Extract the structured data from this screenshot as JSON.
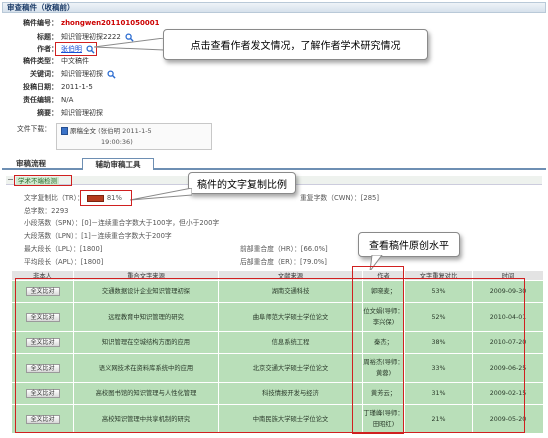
{
  "title": "审查稿件（收稿前）",
  "meta": {
    "manuscript_no_label": "稿件编号：",
    "manuscript_no": "zhongwen201101050001",
    "title_label": "标题：",
    "title_value": "知识管理初探2222",
    "author_label": "作者：",
    "author_value": "张伯明",
    "category_label": "稿件类型：",
    "category_value": "中文稿件",
    "keywords_label": "关键词：",
    "keywords_value": "知识管理初探",
    "date_label": "投稿日期：",
    "date_value": "2011-1-5",
    "editor_label": "责任编辑：",
    "editor_value": "N/A",
    "abstract_label": "摘要：",
    "abstract_value": "知识管理初探"
  },
  "file": {
    "label": "文件下载：",
    "name": "原稿全文",
    "info_line1": "(张伯明 2011-1-5",
    "info_line2": "19:00:36)"
  },
  "tabs": [
    "审稿流程",
    "辅助审稿工具"
  ],
  "section_label": "学术不端检测",
  "stats": {
    "copy_ratio_label": "文字复制比（TR）：",
    "copy_ratio_value": "81%",
    "repeat_count_label": "重复字数（CWN）：",
    "repeat_count_value": "[285]",
    "total_chars": "总字数：2293",
    "spn": "小段落数（SPN）：[0]－连续重合字数大于100字，但小于200字",
    "lpn": "大段落数（LPN）：[1]－连续重合字数大于200字",
    "lpl": "最大段长（LPL）：[1800]",
    "apl": "平均段长（APL）：[1800]",
    "hr": "前部重合度（HR）：[66.0%]",
    "er": "后部重合度（ER）：[79.0%]"
  },
  "callouts": {
    "author": "点击查看作者发文情况，了解作者学术研究情况",
    "ratio": "稿件的文字复制比例",
    "originality": "查看稿件原创水平"
  },
  "table": {
    "headers": [
      "非本人",
      "重合文字来源",
      "文献来源",
      "作者",
      "文字重复对比",
      "时间"
    ],
    "button_label": "全文比对",
    "rows": [
      {
        "title": "交通数据设计企业知识管理初探",
        "source": "湖南交通科技",
        "author": "郭晓麦；",
        "ratio": "53%",
        "date": "2009-09-30"
      },
      {
        "title": "远程教育中知识管理的研究",
        "source": "曲阜师范大学硕士学位论文",
        "author": "位文娟(导师：李兴保)",
        "ratio": "52%",
        "date": "2010-04-01"
      },
      {
        "title": "知识管理在空城结构方面的应用",
        "source": "信息系统工程",
        "author": "秦杰；",
        "ratio": "38%",
        "date": "2010-07-20"
      },
      {
        "title": "语义网技术在资料库系统中的应用",
        "source": "北京交通大学硕士学位论文",
        "author": "周裕杰(导师：黄蓉)",
        "ratio": "33%",
        "date": "2009-06-25"
      },
      {
        "title": "高校图书馆的知识管理与人性化管理",
        "source": "科技情报开发与经济",
        "author": "黄芳云；",
        "ratio": "31%",
        "date": "2009-02-15"
      },
      {
        "title": "高校知识管理中共享机制的研究",
        "source": "中南民族大学硕士学位论文",
        "author": "丁瑾峰(导师：田昭红)",
        "ratio": "21%",
        "date": "2009-05-20"
      }
    ]
  },
  "colors": {
    "annotation_red": "#d02020",
    "copy_ratio_bar": "#b53a1e",
    "row_green": "#b9dfb9",
    "title_blue": "#1a3a66"
  }
}
